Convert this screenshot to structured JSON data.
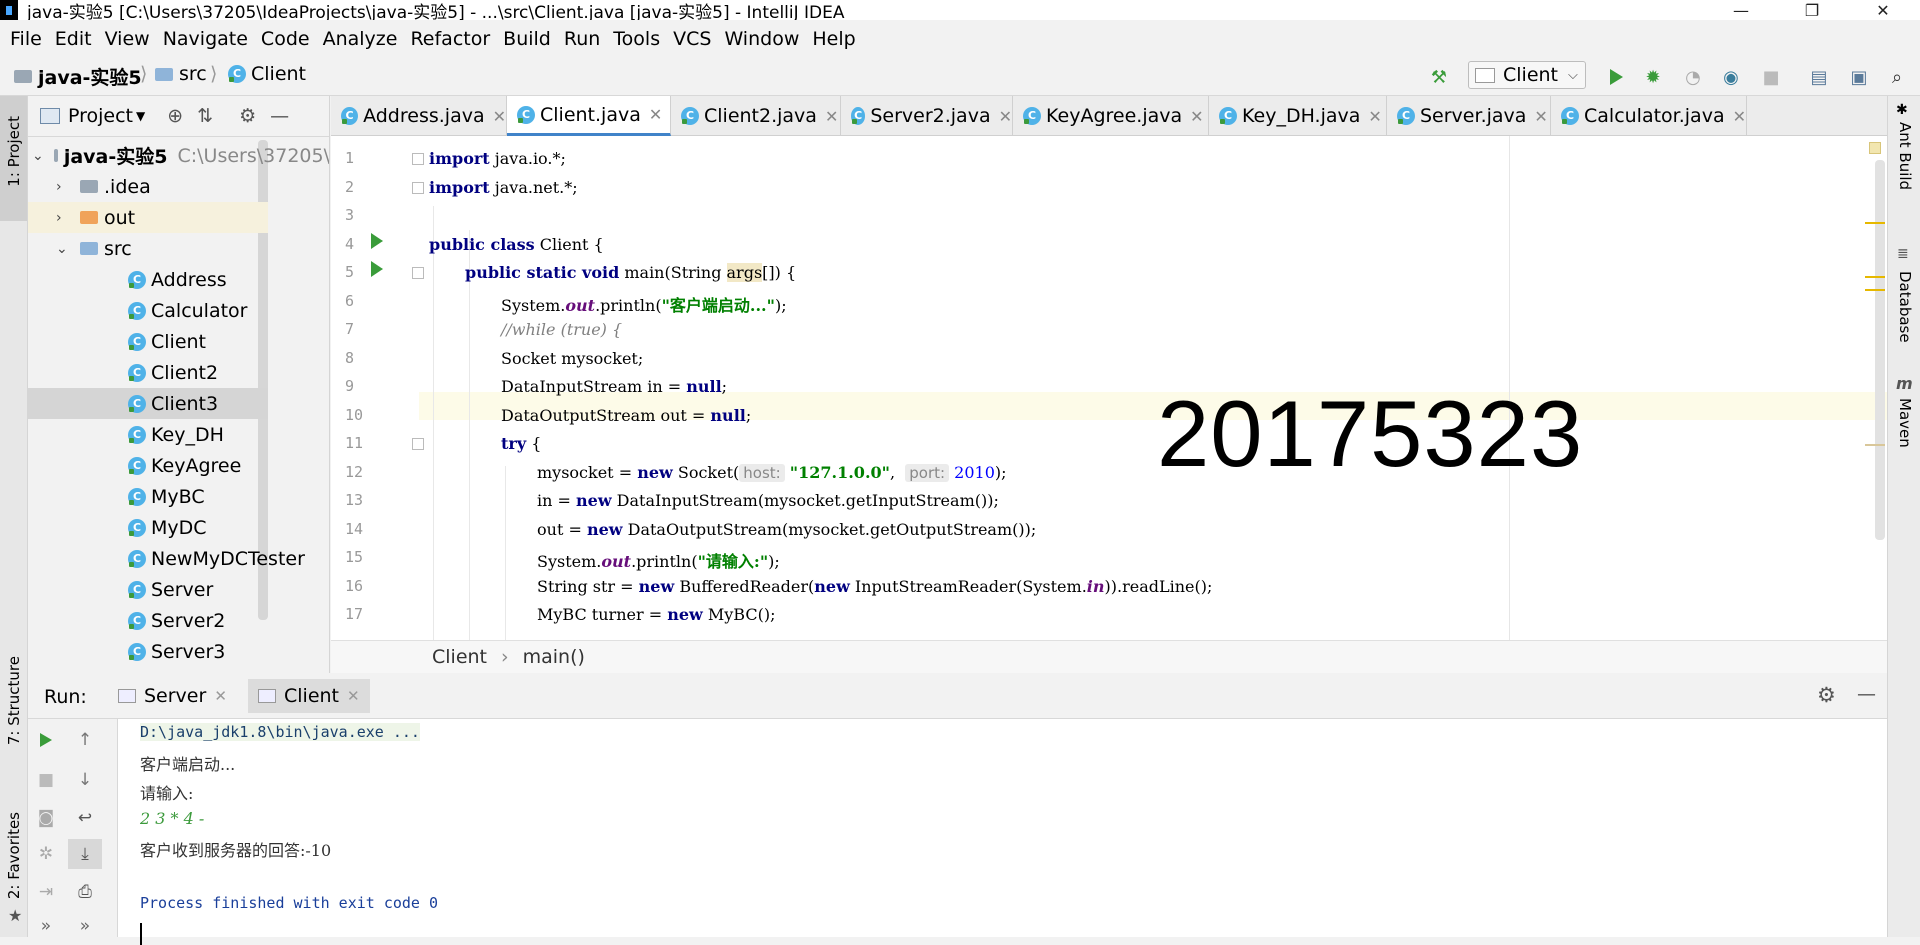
{
  "window": {
    "title": "java-实验5 [C:\\Users\\37205\\IdeaProjects\\java-实验5] - ...\\src\\Client.java [java-实验5] - IntelliJ IDEA",
    "minimize": "—",
    "maximize": "❐",
    "close": "✕"
  },
  "menu": [
    "File",
    "Edit",
    "View",
    "Navigate",
    "Code",
    "Analyze",
    "Refactor",
    "Build",
    "Run",
    "Tools",
    "VCS",
    "Window",
    "Help"
  ],
  "nav": {
    "project": "java-实验5",
    "src": "src",
    "file": "Client",
    "run_config": "Client"
  },
  "left_strip": {
    "project": "1: Project",
    "structure": "7: Structure",
    "favorites": "2: Favorites"
  },
  "right_strip": {
    "ant": "Ant Build",
    "database": "Database",
    "maven": "Maven"
  },
  "project_panel": {
    "title": "Project",
    "root": "java-实验5",
    "root_path": "C:\\Users\\37205\\",
    "items": [
      ".idea",
      "out",
      "src",
      "Address",
      "Calculator",
      "Client",
      "Client2",
      "Client3",
      "Key_DH",
      "KeyAgree",
      "MyBC",
      "MyDC",
      "NewMyDCTester",
      "Server",
      "Server2",
      "Server3"
    ]
  },
  "tabs": [
    "Address.java",
    "Client.java",
    "Client2.java",
    "Server2.java",
    "KeyAgree.java",
    "Key_DH.java",
    "Server.java",
    "Calculator.java"
  ],
  "code": {
    "line_numbers": [
      "1",
      "2",
      "3",
      "4",
      "5",
      "6",
      "7",
      "8",
      "9",
      "10",
      "11",
      "12",
      "13",
      "14",
      "15",
      "16",
      "17"
    ],
    "l1a": "import",
    "l1b": " java.io.*;",
    "l2a": "import",
    "l2b": " java.net.*;",
    "l4a": "public class",
    "l4b": " Client {",
    "l5a": "public static void",
    "l5b": " main(String ",
    "l5c": "args",
    "l5d": "[]) {",
    "l6a": "System.",
    "l6b": "out",
    "l6c": ".println(",
    "l6d": "\"客户端启动...\"",
    "l6e": ");",
    "l7": "//while (true) {",
    "l8": "Socket mysocket;",
    "l9a": "DataInputStream in = ",
    "l9b": "null",
    "l9c": ";",
    "l10a": "DataOutputStream out = ",
    "l10b": "null",
    "l10c": ";",
    "l11a": "try",
    "l11b": " {",
    "l12a": "mysocket = ",
    "l12b": "new",
    "l12c": " Socket(",
    "l12h1": "host:",
    "l12s": "\"127.1.0.0\"",
    "l12d": ",  ",
    "l12h2": "port:",
    "l12n": "2010",
    "l12e": ");",
    "l13a": "in = ",
    "l13b": "new",
    "l13c": " DataInputStream(mysocket.getInputStream());",
    "l14a": "out = ",
    "l14b": "new",
    "l14c": " DataOutputStream(mysocket.getOutputStream());",
    "l15a": "System.",
    "l15b": "out",
    "l15c": ".println(",
    "l15d": "\"请输入:\"",
    "l15e": ");",
    "l16a": "String str = ",
    "l16b": "new",
    "l16c": " BufferedReader(",
    "l16d": "new",
    "l16e": " InputStreamReader(System.",
    "l16f": "in",
    "l16g": ")).readLine();",
    "l17a": "MyBC turner = ",
    "l17b": "new",
    "l17c": " MyBC();"
  },
  "editor_breadcrumb": [
    "Client",
    "main()"
  ],
  "watermark": "20175323",
  "run": {
    "label": "Run:",
    "tabs": [
      "Server",
      "Client"
    ],
    "console": {
      "cmd": "D:\\java_jdk1.8\\bin\\java.exe ...",
      "line1": "客户端启动...",
      "line2": "请输入:",
      "input": "2 3 * 4 -",
      "line3": "客户收到服务器的回答:-10",
      "exit": "Process finished with exit code 0"
    }
  },
  "colors": {
    "keyword": "#000080",
    "string": "#008000",
    "number": "#0000ff",
    "run_green": "#3a9c3a",
    "tab_underline": "#4083c9"
  }
}
